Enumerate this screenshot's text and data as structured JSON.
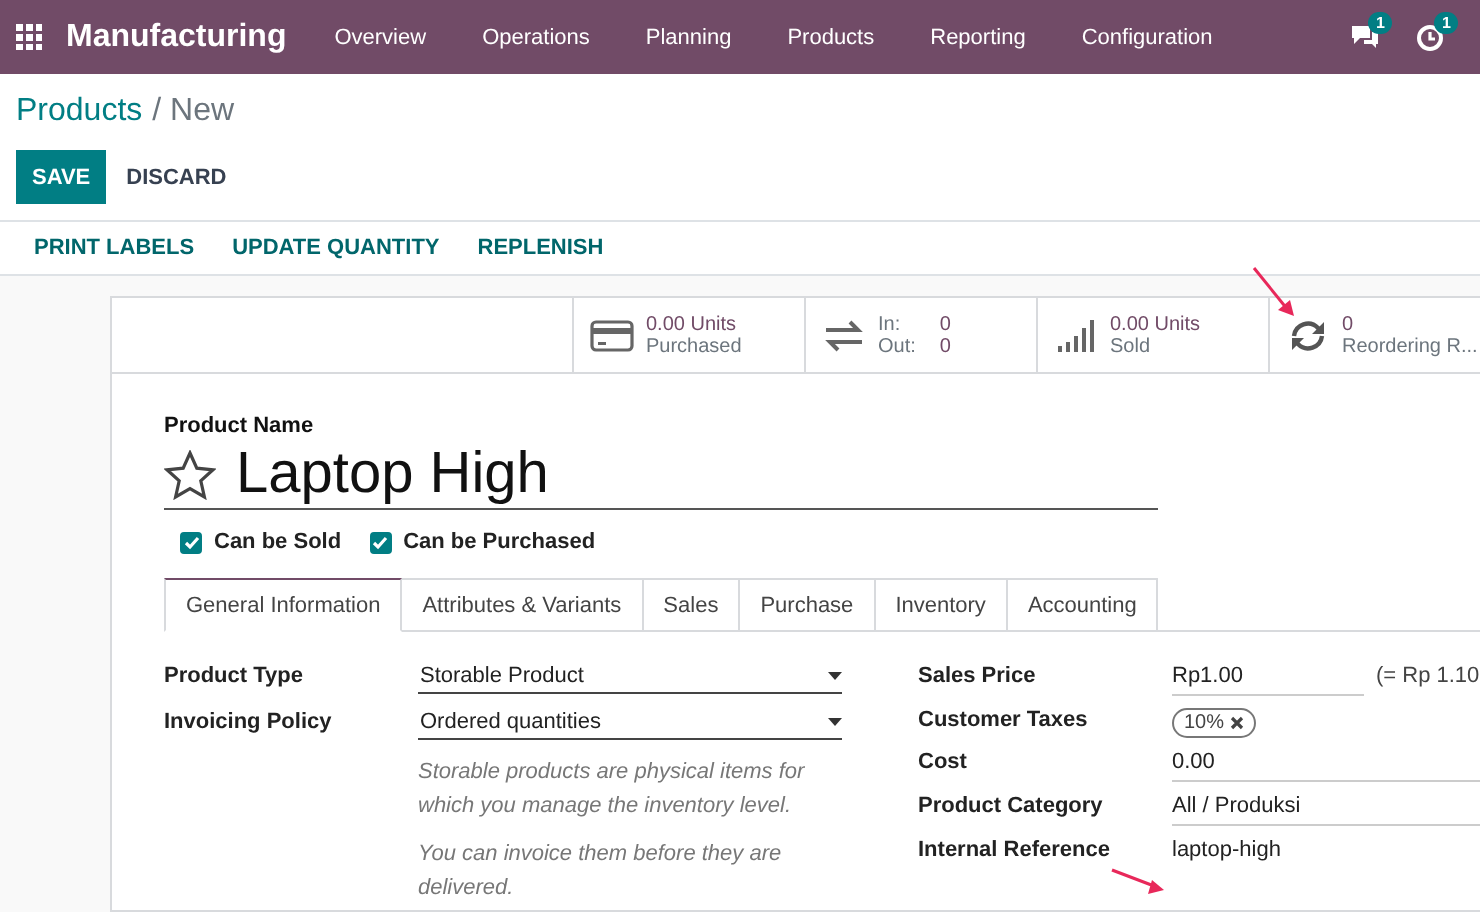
{
  "navbar": {
    "app_name": "Manufacturing",
    "menu": [
      {
        "label": "Overview"
      },
      {
        "label": "Operations"
      },
      {
        "label": "Planning"
      },
      {
        "label": "Products"
      },
      {
        "label": "Reporting"
      },
      {
        "label": "Configuration"
      }
    ],
    "indicators": [
      {
        "kind": "chat",
        "count": "1"
      },
      {
        "kind": "activity",
        "count": "1"
      }
    ]
  },
  "breadcrumb": {
    "parent": "Products",
    "current": "/ New"
  },
  "buttons": {
    "primary": "SAVE",
    "secondary": "DISCARD"
  },
  "actions": [
    {
      "label": "PRINT LABELS"
    },
    {
      "label": "UPDATE QUANTITY"
    },
    {
      "label": "REPLENISH"
    }
  ],
  "stat_buttons": [
    {
      "kind": "purchased",
      "value": "0.00 Units",
      "label": "Purchased"
    },
    {
      "kind": "moves",
      "in_label": "In:",
      "in_value": "0",
      "out_label": "Out:",
      "out_value": "0"
    },
    {
      "kind": "sold",
      "value": "0.00 Units",
      "label": "Sold"
    },
    {
      "kind": "reordering",
      "value": "0",
      "label": "Reordering R..."
    }
  ],
  "product": {
    "name_label": "Product Name",
    "name": "Laptop High",
    "starred": false
  },
  "options": [
    {
      "label": "Can be Sold",
      "checked": true
    },
    {
      "label": "Can be Purchased",
      "checked": true
    }
  ],
  "tabs": [
    {
      "label": "General Information",
      "selected": true
    },
    {
      "label": "Attributes & Variants",
      "selected": false
    },
    {
      "label": "Sales",
      "selected": false
    },
    {
      "label": "Purchase",
      "selected": false
    },
    {
      "label": "Inventory",
      "selected": false
    },
    {
      "label": "Accounting",
      "selected": false
    }
  ],
  "left_fields": [
    {
      "label": "Product Type",
      "value": "Storable Product",
      "kind": "select"
    },
    {
      "label": "Invoicing Policy",
      "value": "Ordered quantities",
      "kind": "select"
    }
  ],
  "help_texts": [
    "Storable products are physical items for which you manage the inventory level.",
    "You can invoice them before they are delivered."
  ],
  "right_fields": [
    {
      "label": "Sales Price",
      "value": "Rp1.00",
      "extra": "(= Rp 1.10",
      "kind": "text"
    },
    {
      "label": "Customer Taxes",
      "value": "10%",
      "kind": "tag"
    },
    {
      "label": "Cost",
      "value": "0.00",
      "kind": "text"
    },
    {
      "label": "Product Category",
      "value": "All / Produksi",
      "kind": "text"
    },
    {
      "label": "Internal Reference",
      "value": "laptop-high",
      "kind": "plain"
    }
  ]
}
